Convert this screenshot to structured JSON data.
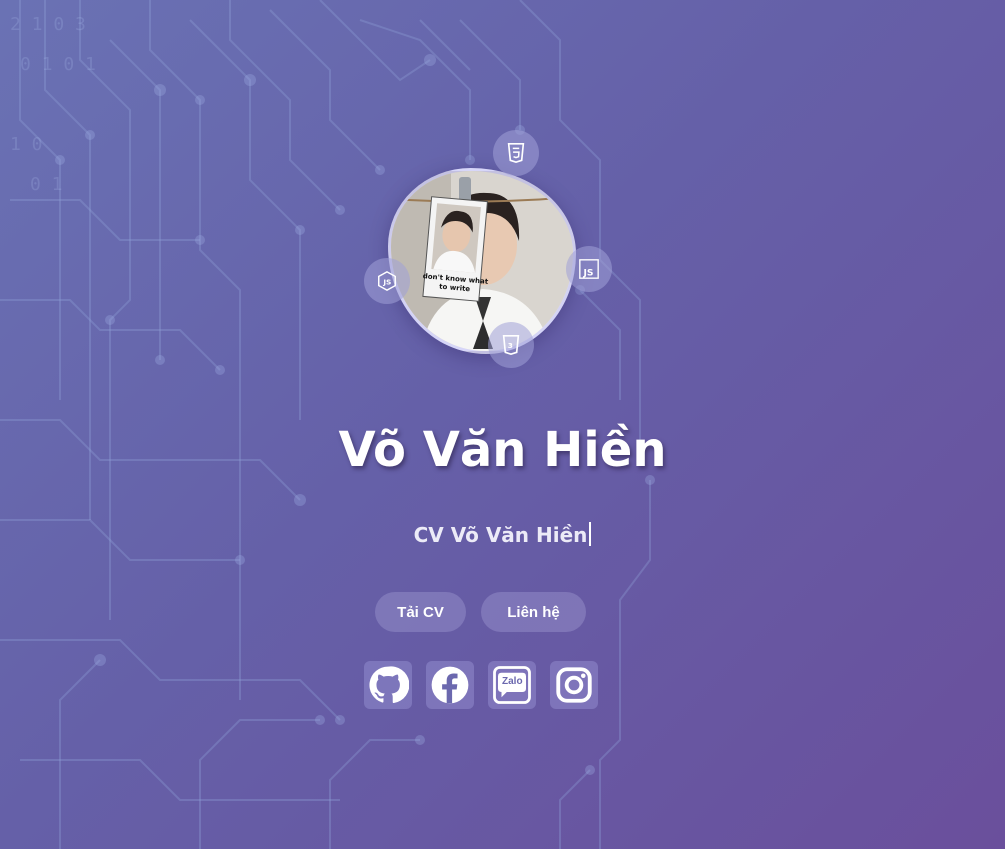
{
  "profile": {
    "name": "Võ Văn Hiền",
    "subtitle": "CV Võ Văn Hiền",
    "photo_caption": "don't know what to write"
  },
  "actions": {
    "download_cv": "Tải CV",
    "contact": "Liên hệ"
  },
  "tech_badges": [
    {
      "icon": "html5-icon"
    },
    {
      "icon": "javascript-icon"
    },
    {
      "icon": "nodejs-icon"
    },
    {
      "icon": "css3-icon"
    }
  ],
  "social_links": [
    {
      "icon": "github-icon"
    },
    {
      "icon": "facebook-icon"
    },
    {
      "icon": "zalo-icon",
      "label": "Zalo"
    },
    {
      "icon": "instagram-icon"
    }
  ],
  "colors": {
    "background_start": "#6a72b4",
    "background_end": "#6a4f9c",
    "text": "#ffffff"
  }
}
